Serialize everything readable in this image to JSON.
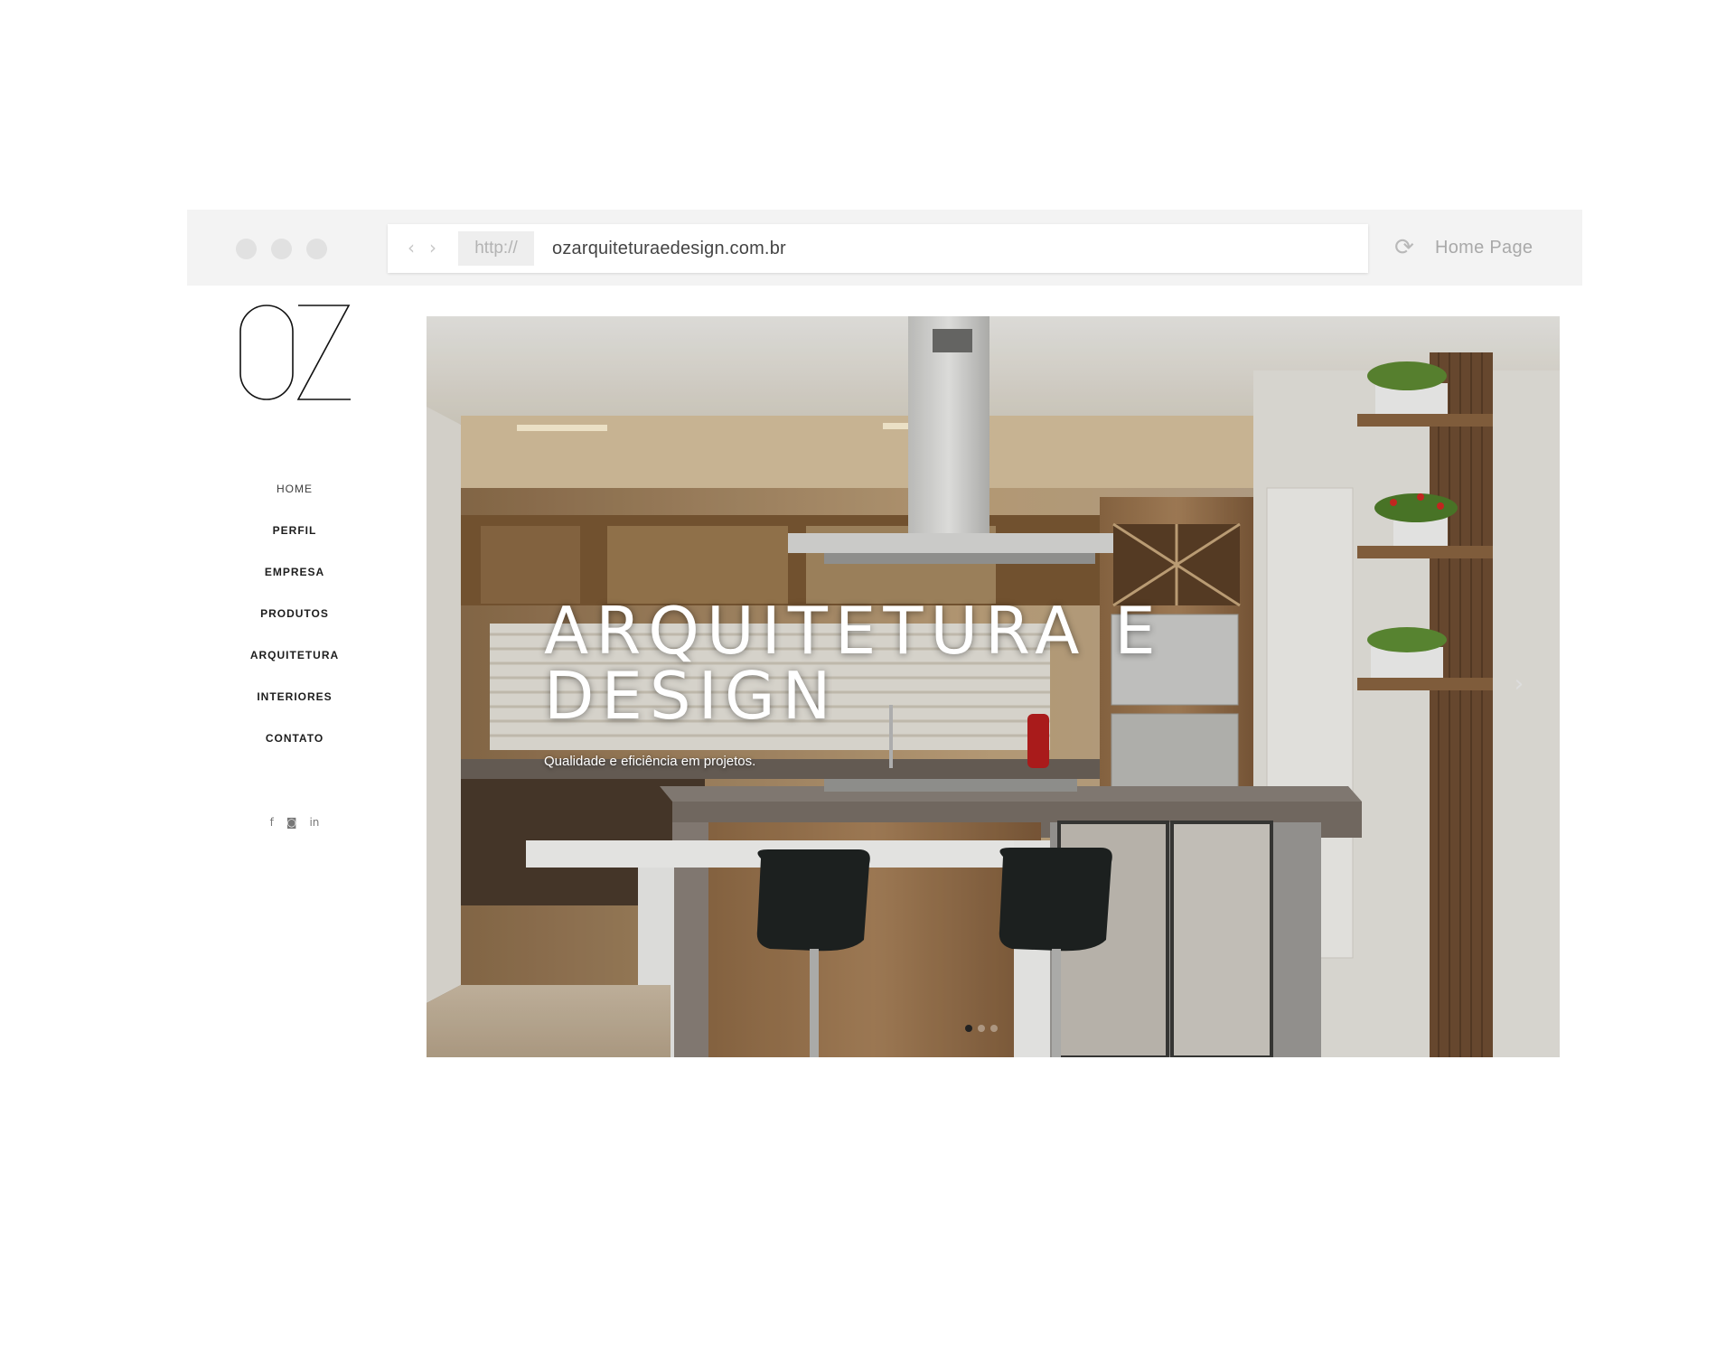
{
  "browser": {
    "protocol": "http://",
    "url": "ozarquiteturaedesign.com.br",
    "home_label": "Home Page",
    "back_glyph": "‹",
    "forward_glyph": "›",
    "reload_glyph": "⟳"
  },
  "logo": {
    "letters": "OZ"
  },
  "sidebar": {
    "items": [
      {
        "label": "HOME"
      },
      {
        "label": "PERFIL"
      },
      {
        "label": "EMPRESA"
      },
      {
        "label": "PRODUTOS"
      },
      {
        "label": "ARQUITETURA"
      },
      {
        "label": "INTERIORES"
      },
      {
        "label": "CONTATO"
      }
    ],
    "social": {
      "facebook": "f",
      "instagram": "◙",
      "linkedin": "in"
    }
  },
  "hero": {
    "title": "ARQUITETURA E DESIGN",
    "subtitle": "Qualidade e eficiência em projetos.",
    "next_glyph": "›",
    "slide_count": 3,
    "active_slide": 1
  },
  "colors": {
    "chrome_bg": "#f3f3f3",
    "menu_text": "#1d1d1d",
    "hero_text": "#ffffff"
  }
}
